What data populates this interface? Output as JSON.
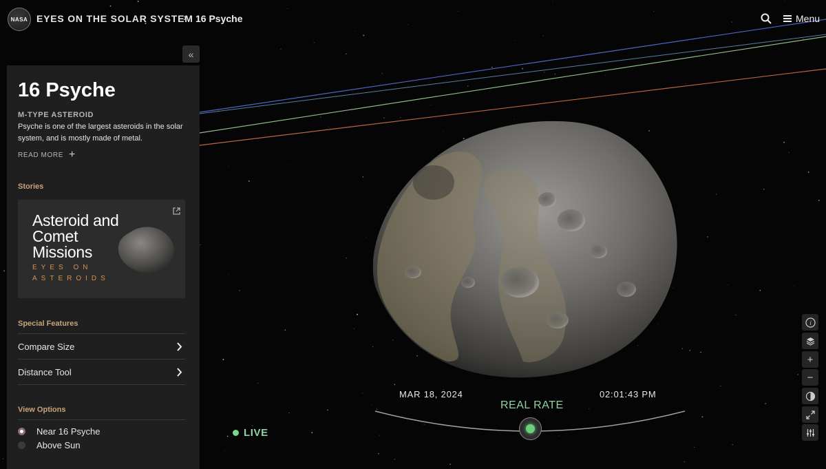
{
  "header": {
    "logo_text": "NASA",
    "app_title": "EYES ON THE SOLAR SYSTEM",
    "breadcrumb_sep": "›",
    "breadcrumb_current": "16 Psyche",
    "menu_label": "Menu",
    "search_icon": "search-icon",
    "menu_icon": "hamburger-icon"
  },
  "panel": {
    "collapse_label": "«",
    "title": "16 Psyche",
    "subtype": "M-TYPE ASTEROID",
    "description": "Psyche is one of the largest asteroids in the solar system, and is mostly made of metal.",
    "read_more": "READ MORE",
    "read_more_icon": "+",
    "stories_heading": "Stories",
    "story": {
      "title": "Asteroid and Comet Missions",
      "subtitle": "EYES ON ASTEROIDS",
      "external_icon": "external-link-icon"
    },
    "special_features_heading": "Special Features",
    "features": [
      {
        "label": "Compare Size"
      },
      {
        "label": "Distance Tool"
      }
    ],
    "view_options_heading": "View Options",
    "view_options": [
      {
        "label": "Near 16 Psyche",
        "selected": true
      },
      {
        "label": "Above Sun",
        "selected": false
      }
    ]
  },
  "time": {
    "date": "MAR 18, 2024",
    "clock": "02:01:43 PM",
    "rate": "REAL RATE",
    "live": "LIVE"
  },
  "toolbar": {
    "info": "info-icon",
    "layers": "layers-icon",
    "zoom_in": "+",
    "zoom_out": "−",
    "lighting": "lighting-icon",
    "fullscreen": "fullscreen-icon",
    "settings": "settings-sliders-icon"
  },
  "colors": {
    "accent_stories": "#c8a37a",
    "live_green": "#8fd3a3",
    "panel_bg": "#1f1f1f",
    "orbit_blue": "#5a6fd8",
    "orbit_green": "#9fd6a0",
    "orbit_orange": "#d87a4a"
  }
}
